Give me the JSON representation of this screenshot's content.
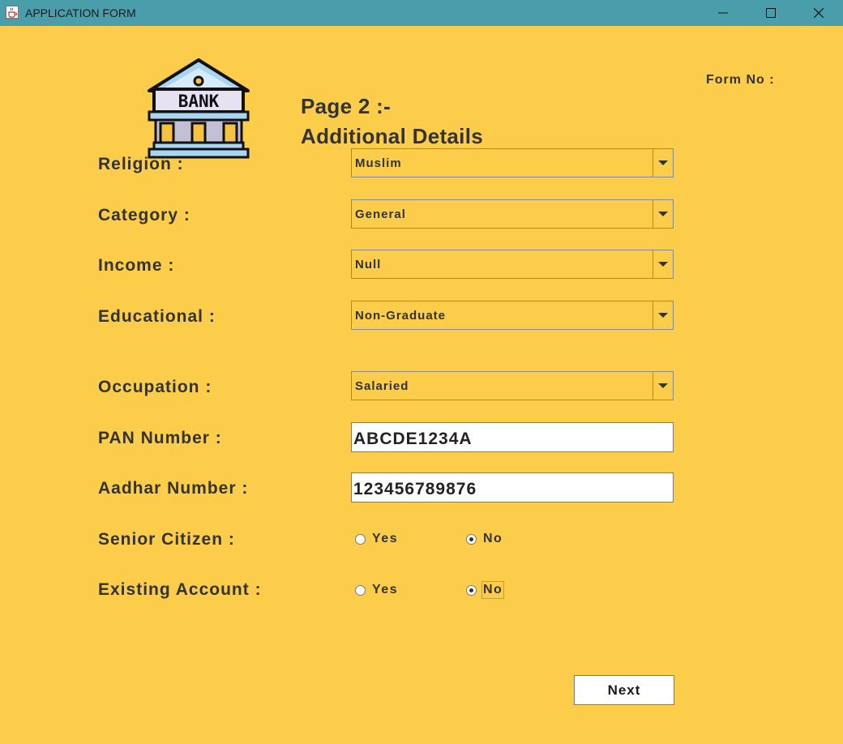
{
  "window": {
    "title": "APPLICATION FORM"
  },
  "header": {
    "logo_text": "BANK",
    "page": "Page 2 :-",
    "subtitle": "Additional Details",
    "form_no_label": "Form No :"
  },
  "fields": {
    "religion": {
      "label": "Religion :",
      "value": "Muslim"
    },
    "category": {
      "label": "Category :",
      "value": "General"
    },
    "income": {
      "label": "Income :",
      "value": "Null"
    },
    "educational": {
      "label": "Educational :",
      "value": "Non-Graduate"
    },
    "occupation": {
      "label": "Occupation :",
      "value": "Salaried"
    },
    "pan": {
      "label": "PAN Number :",
      "value": "ABCDE1234A"
    },
    "aadhar": {
      "label": "Aadhar Number :",
      "value": "123456789876"
    },
    "senior_citizen": {
      "label": "Senior Citizen :",
      "yes": "Yes",
      "no": "No",
      "selected": "No"
    },
    "existing_account": {
      "label": "Existing Account :",
      "yes": "Yes",
      "no": "No",
      "selected": "No"
    }
  },
  "actions": {
    "next": "Next"
  },
  "colors": {
    "background": "#fccd4a",
    "titlebar": "#4a9eab",
    "text": "#333333"
  },
  "icons": {
    "app": "java-cup-icon",
    "minimize": "minimize-icon",
    "maximize": "maximize-icon",
    "close": "close-icon",
    "logo": "bank-building-icon"
  }
}
